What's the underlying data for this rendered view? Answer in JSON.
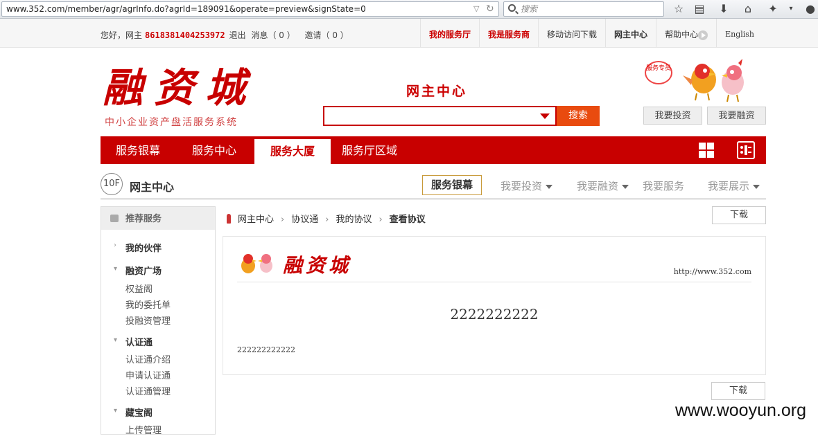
{
  "browser": {
    "url": "www.352.com/member/agr/agrInfo.do?agrId=189091&operate=preview&signState=0",
    "search_placeholder": "搜索"
  },
  "topbar": {
    "greeting": "您好，网主",
    "phone": "8618381404253972",
    "logout": "退出",
    "messages": "消息（ 0 ）",
    "invites": "邀请（ 0 ）",
    "links": [
      "我的服务厅",
      "我是服务商",
      "移动访问下载",
      "网主中心",
      "帮助中心",
      "English"
    ]
  },
  "header": {
    "logo": "融资城",
    "logo_sub": "中小企业资产盘活服务系统",
    "center_title": "网主中心",
    "search_button": "搜索",
    "badge": "服务专员",
    "invest_button": "我要投资",
    "finance_button": "我要融资"
  },
  "nav": {
    "items": [
      "服务银幕",
      "服务中心",
      "服务大厦",
      "服务厅区域"
    ],
    "active": "服务大厦"
  },
  "floor": {
    "number": "10F",
    "title": "网主中心",
    "subnav": [
      "服务银幕",
      "我要投资",
      "我要融资",
      "我要服务",
      "我要展示"
    ]
  },
  "sidebar": {
    "head": "推荐服务",
    "groups": [
      {
        "title": "我的伙伴",
        "links": []
      },
      {
        "title": "融资广场",
        "links": [
          "权益阁",
          "我的委托单",
          "投融资管理"
        ]
      },
      {
        "title": "认证通",
        "links": [
          "认证通介绍",
          "申请认证通",
          "认证通管理"
        ]
      },
      {
        "title": "藏宝阁",
        "links": [
          "上传管理"
        ]
      }
    ]
  },
  "breadcrumb": [
    "网主中心",
    "协议通",
    "我的协议",
    "查看协议"
  ],
  "download_label": "下载",
  "document": {
    "logo": "融资城",
    "url": "http://www.352.com",
    "title": "2222222222",
    "body": "222222222222"
  },
  "watermark": "www.wooyun.org",
  "colors": {
    "brand_red": "#c80000",
    "search_orange": "#e94b0f"
  }
}
